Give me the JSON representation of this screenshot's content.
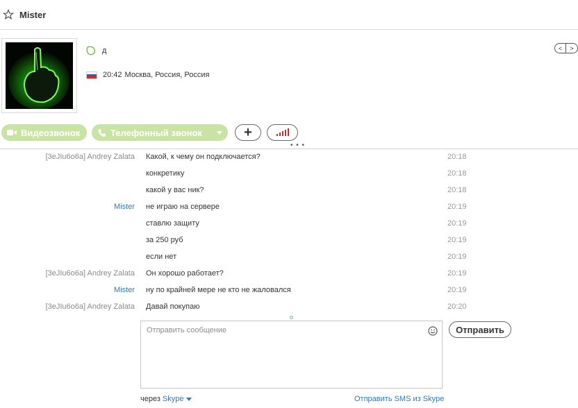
{
  "header": {
    "title": "Mister"
  },
  "profile": {
    "mood": "д",
    "local_time": "20:42",
    "location": "Москва, Россия, Россия"
  },
  "nav": {
    "prev": "<",
    "next": ">"
  },
  "calls": {
    "video_label": "Видеозвонок",
    "phone_label": "Телефонный звонок",
    "add_label": "+"
  },
  "messages": [
    {
      "sender": "[3eJIu6o6a] Andrey Zalata",
      "text": "Какой, к чему он подключается?",
      "time": "20:18"
    },
    {
      "sender": "",
      "text": "конкретику",
      "time": "20:18"
    },
    {
      "sender": "",
      "text": "какой у вас ник?",
      "time": "20:18"
    },
    {
      "sender": "Mister",
      "text": "не играю на сервере",
      "time": "20:19"
    },
    {
      "sender": "",
      "text": "ставлю защиту",
      "time": "20:19"
    },
    {
      "sender": "",
      "text": "за 250 руб",
      "time": "20:19"
    },
    {
      "sender": "",
      "text": "если нет",
      "time": "20:19"
    },
    {
      "sender": "[3eJIu6o6a] Andrey Zalata",
      "text": "Он хорошо работает?",
      "time": "20:19"
    },
    {
      "sender": "Mister",
      "text": "ну по крайней мере не кто не жаловался",
      "time": "20:19"
    },
    {
      "sender": "[3eJIu6o6a] Andrey Zalata",
      "text": "Давай покупаю",
      "time": "20:20"
    }
  ],
  "composer": {
    "placeholder": "Отправить сообщение",
    "send_label": "Отправить",
    "via_prefix": "через",
    "via_service": "Skype",
    "sms_link": "Отправить SMS из Skype"
  },
  "colors": {
    "accent_green": "#c9e3a5",
    "link_blue": "#2b7ab8",
    "signal_red": "#c0282d"
  }
}
